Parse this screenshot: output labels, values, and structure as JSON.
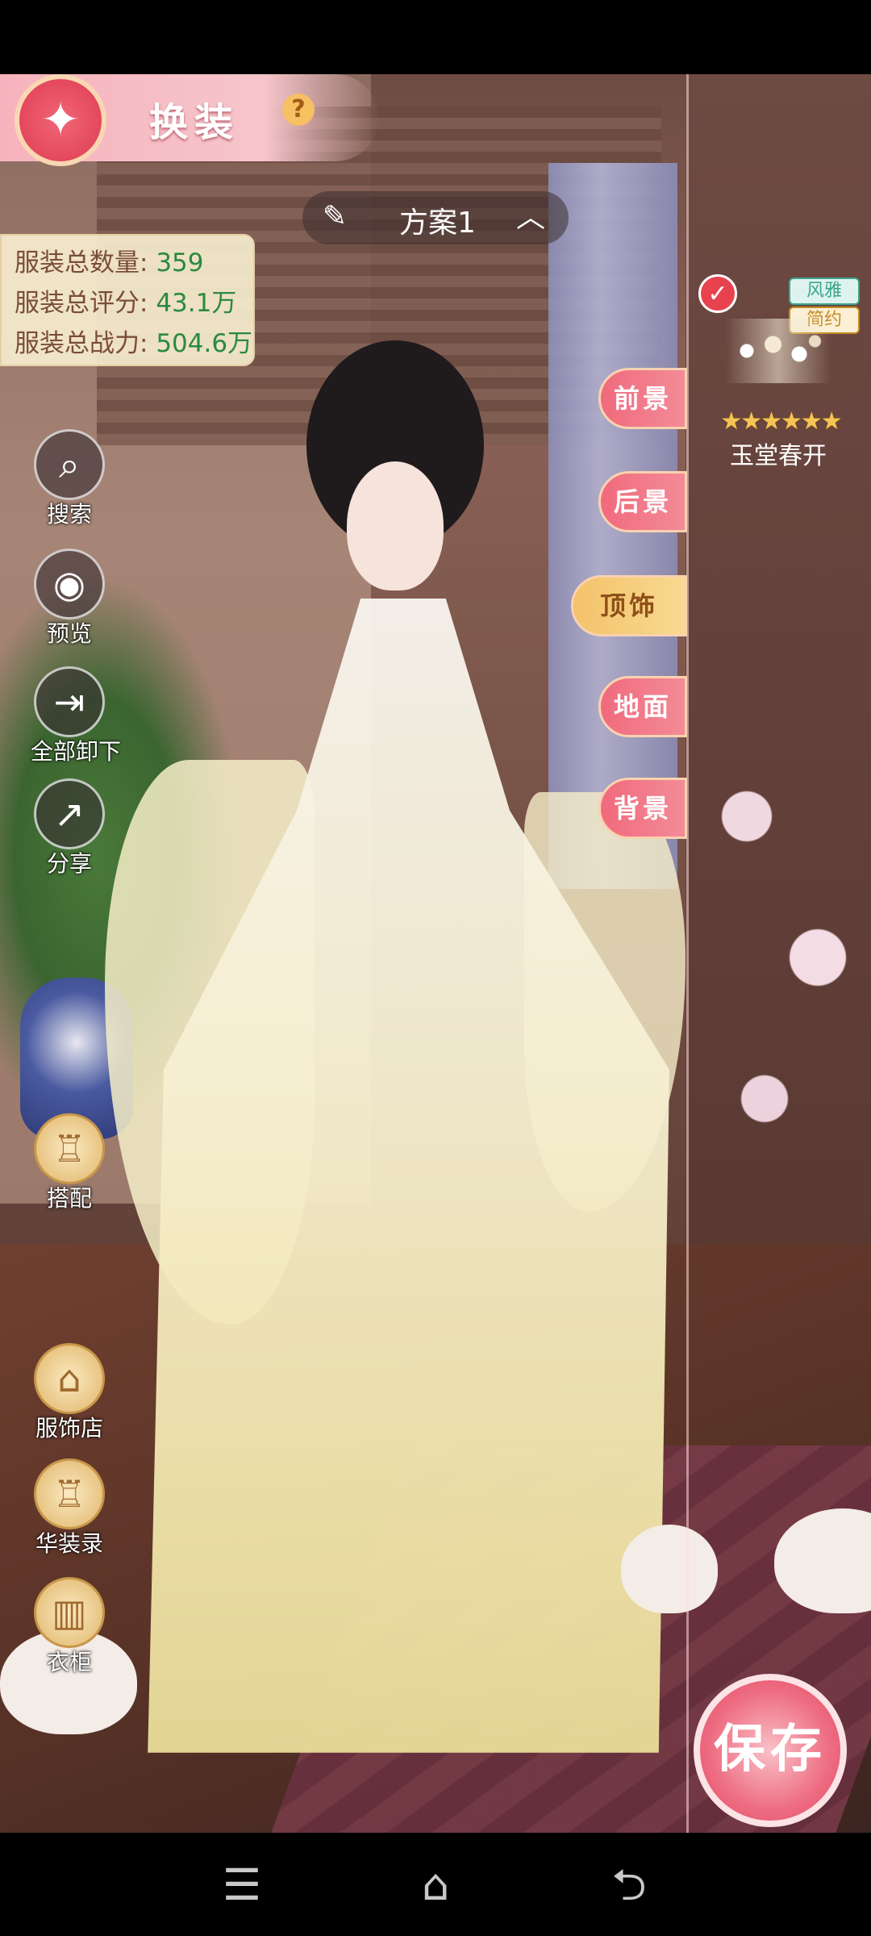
{
  "header": {
    "title": "换装",
    "help": "?"
  },
  "plan": {
    "label": "方案1"
  },
  "stats": {
    "count_label": "服装总数量:",
    "count_value": "359",
    "score_label": "服装总评分:",
    "score_value": "43.1万",
    "power_label": "服装总战力:",
    "power_value": "504.6万"
  },
  "side_buttons": [
    {
      "label": "搜索",
      "icon": "search-icon"
    },
    {
      "label": "预览",
      "icon": "eye-icon"
    },
    {
      "label": "全部卸下",
      "icon": "unequip-all-icon"
    },
    {
      "label": "分享",
      "icon": "share-icon"
    },
    {
      "label": "搭配",
      "icon": "outfit-match-icon"
    },
    {
      "label": "服饰店",
      "icon": "shop-icon"
    },
    {
      "label": "华装录",
      "icon": "collection-icon"
    },
    {
      "label": "衣柜",
      "icon": "wardrobe-icon"
    }
  ],
  "categories": [
    {
      "label": "前景"
    },
    {
      "label": "后景"
    },
    {
      "label": "顶饰",
      "active": true
    },
    {
      "label": "地面"
    },
    {
      "label": "背景"
    }
  ],
  "selected_item": {
    "tags": [
      "风雅",
      "简约"
    ],
    "stars": 6,
    "stars_text": "★★★★★★",
    "name": "玉堂春开"
  },
  "save": {
    "label": "保存"
  },
  "colors": {
    "accent_pink": "#f06a7c",
    "active_gold": "#f4c26a",
    "stat_value_green": "#2b8a3e"
  }
}
